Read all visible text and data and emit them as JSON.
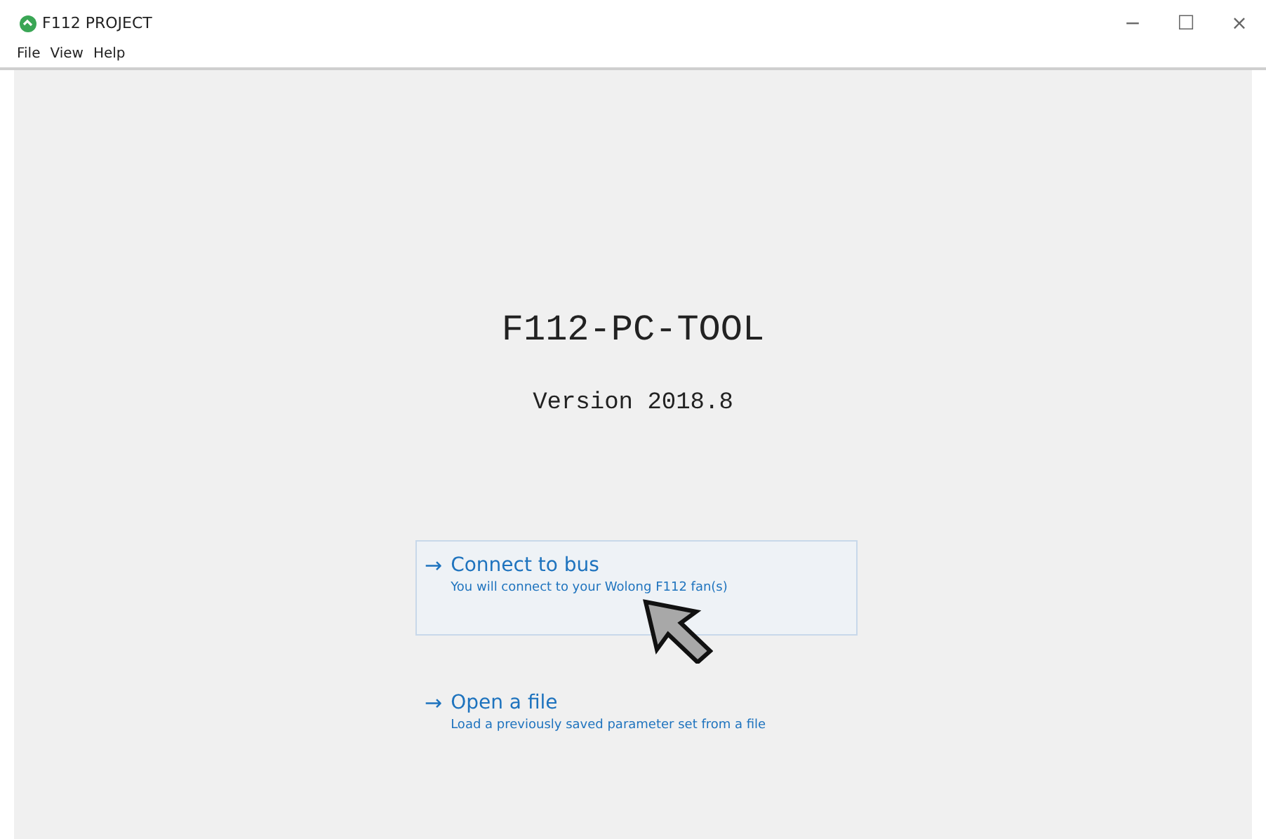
{
  "window": {
    "title": "F112 PROJECT",
    "controls": [
      "−",
      "☐",
      "×"
    ]
  },
  "menu": [
    "File",
    "View",
    "Help"
  ],
  "app_title": "F112-PC-TOOL",
  "version": "Version 2018.8",
  "commands": [
    {
      "arrow": "→",
      "label": "Connect to bus",
      "description": "You will connect to your Wolong F112 fan(s)",
      "highlighted": true
    },
    {
      "arrow": "→",
      "label": "Open a file",
      "description": "Load a previously saved parameter set from a file",
      "highlighted": false
    }
  ]
}
